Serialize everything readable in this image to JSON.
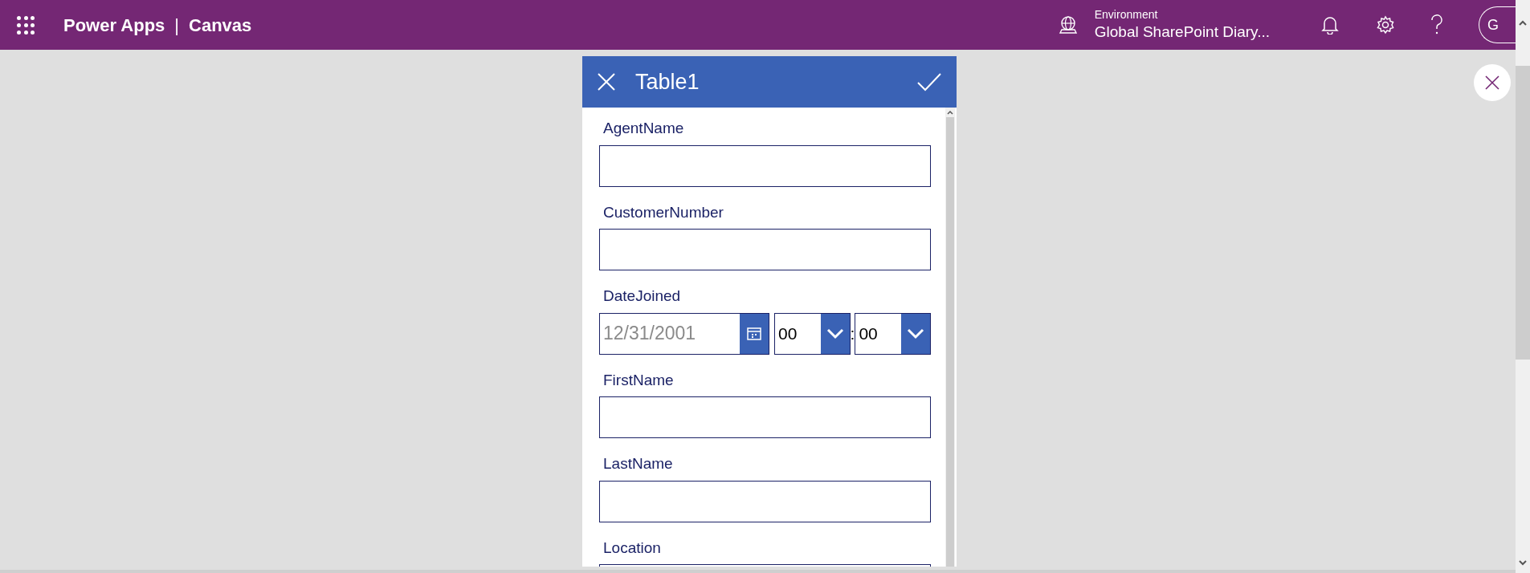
{
  "app_bar": {
    "title": "Power Apps",
    "separator": "|",
    "section": "Canvas",
    "environment_label": "Environment",
    "environment_name": "Global SharePoint Diary...",
    "avatar_initials": "G"
  },
  "form": {
    "title": "Table1",
    "fields": [
      {
        "kind": "text",
        "label": "AgentName"
      },
      {
        "kind": "text",
        "label": "CustomerNumber"
      },
      {
        "kind": "datetime",
        "label": "DateJoined",
        "date_placeholder": "12/31/2001",
        "hour": "00",
        "separator": ":",
        "minute": "00"
      },
      {
        "kind": "text",
        "label": "FirstName"
      },
      {
        "kind": "text",
        "label": "LastName"
      },
      {
        "kind": "text",
        "label": "Location"
      }
    ]
  }
}
